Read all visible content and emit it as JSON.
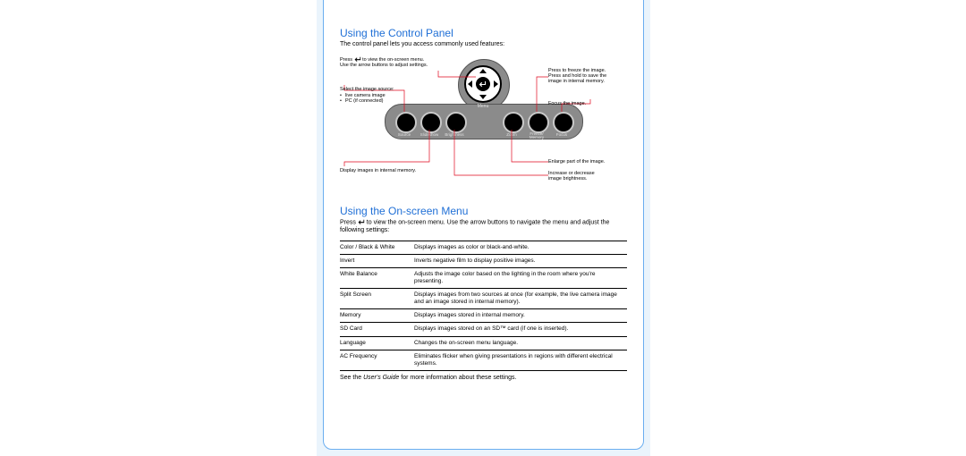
{
  "section1": {
    "title": "Using the Control Panel",
    "intro": "The control panel lets you access commonly used features:"
  },
  "diagram": {
    "menu_label": "Menu",
    "buttons": [
      "Source",
      "Slideshow",
      "Brightness",
      "Zoom",
      "Freeze/\nMemory",
      "Focus"
    ],
    "callouts": {
      "top_left_a": "Press ",
      "top_left_b": " to view the on-screen menu.\nUse the arrow buttons to adjust settings.",
      "mid_left_a": "Select the image source:",
      "mid_left_items": [
        "live camera image",
        "PC (if connected)"
      ],
      "bottom_left": "Display images in internal memory.",
      "top_right": "Press to freeze the image.\nPress and hold to save the\nimage in internal memory.",
      "mid_right": "Focus the image.",
      "bottom_right_a": "Enlarge part of the image.",
      "bottom_right_b": "Increase or decrease\nimage brightness."
    }
  },
  "section2": {
    "title": "Using the On-screen Menu",
    "intro_a": "Press ",
    "intro_b": " to view the on-screen menu. Use the arrow buttons to navigate the menu and adjust the following settings:",
    "rows": [
      {
        "name": "Color / Black & White",
        "desc": "Displays images as color or black-and-white."
      },
      {
        "name": "Invert",
        "desc": "Inverts negative film to display positive images."
      },
      {
        "name": "White Balance",
        "desc": "Adjusts the image color based on the lighting in the room where you're presenting."
      },
      {
        "name": "Split Screen",
        "desc": "Displays images from two sources at once (for example, the live camera image and an image stored in internal memory)."
      },
      {
        "name": "Memory",
        "desc": "Displays images stored in internal memory."
      },
      {
        "name": "SD Card",
        "desc": "Displays images stored on an SD™ card (if one is inserted)."
      },
      {
        "name": "Language",
        "desc": "Changes the on-screen menu language."
      },
      {
        "name": "AC Frequency",
        "desc": "Eliminates flicker when giving presentations in regions with different electrical systems."
      }
    ],
    "footnote_a": "See the ",
    "footnote_italic": "User's Guide",
    "footnote_b": " for more information about these settings."
  }
}
